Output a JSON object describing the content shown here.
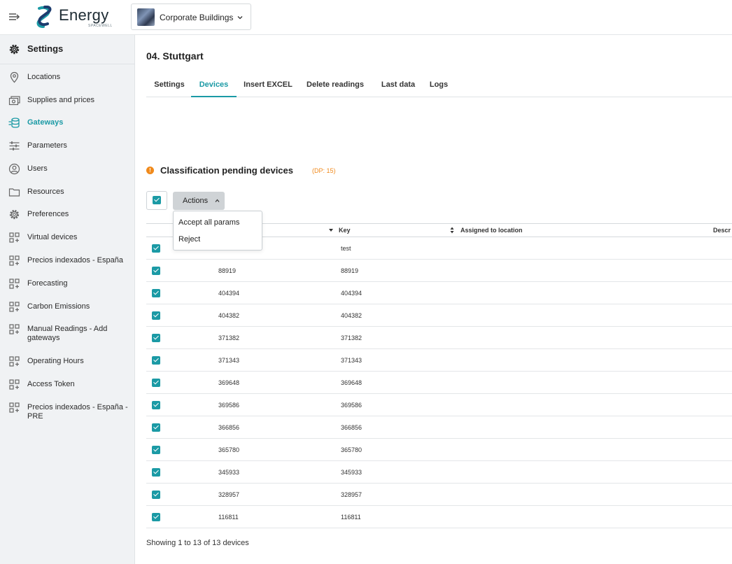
{
  "app": {
    "logo_text": "Energy",
    "logo_sub": "SPACEWELL",
    "building": "Corporate Buildings"
  },
  "sidebar": {
    "header": "Settings",
    "items": [
      {
        "label": "Locations",
        "icon": "location-pin-icon"
      },
      {
        "label": "Supplies and prices",
        "icon": "money-icon"
      },
      {
        "label": "Gateways",
        "icon": "gateway-icon",
        "active": true
      },
      {
        "label": "Parameters",
        "icon": "sliders-icon"
      },
      {
        "label": "Users",
        "icon": "user-circle-icon"
      },
      {
        "label": "Resources",
        "icon": "folder-icon"
      },
      {
        "label": "Preferences",
        "icon": "gear-icon"
      },
      {
        "label": "Virtual devices",
        "icon": "grid-plus-icon"
      },
      {
        "label": "Precios indexados - España",
        "icon": "grid-plus-icon"
      },
      {
        "label": "Forecasting",
        "icon": "grid-plus-icon"
      },
      {
        "label": "Carbon Emissions",
        "icon": "grid-plus-icon"
      },
      {
        "label": "Manual Readings - Add gateways",
        "icon": "grid-plus-icon"
      },
      {
        "label": "Operating Hours",
        "icon": "grid-plus-icon"
      },
      {
        "label": "Access Token",
        "icon": "grid-plus-icon"
      },
      {
        "label": "Precios indexados - España - PRE",
        "icon": "grid-plus-icon"
      }
    ]
  },
  "main": {
    "title": "04. Stuttgart",
    "tabs": [
      "Settings",
      "Devices",
      "Insert EXCEL",
      "Delete readings",
      "Last data",
      "Logs"
    ],
    "active_tab": "Devices",
    "section_title": "Classification pending devices",
    "section_badge": "(DP: 15)",
    "actions_label": "Actions",
    "actions_menu": [
      "Accept all params",
      "Reject"
    ],
    "columns": [
      "Key",
      "Assigned to location",
      "Descr"
    ],
    "rows": [
      {
        "name": "",
        "key": "test"
      },
      {
        "name": "88919",
        "key": "88919"
      },
      {
        "name": "404394",
        "key": "404394"
      },
      {
        "name": "404382",
        "key": "404382"
      },
      {
        "name": "371382",
        "key": "371382"
      },
      {
        "name": "371343",
        "key": "371343"
      },
      {
        "name": "369648",
        "key": "369648"
      },
      {
        "name": "369586",
        "key": "369586"
      },
      {
        "name": "366856",
        "key": "366856"
      },
      {
        "name": "365780",
        "key": "365780"
      },
      {
        "name": "345933",
        "key": "345933"
      },
      {
        "name": "328957",
        "key": "328957"
      },
      {
        "name": "116811",
        "key": "116811"
      }
    ],
    "footer": "Showing 1  to  13  of  13 devices"
  },
  "colors": {
    "accent": "#1b9aa5",
    "warning": "#f08a1c",
    "sidebar_bg": "#f0f2f4"
  }
}
